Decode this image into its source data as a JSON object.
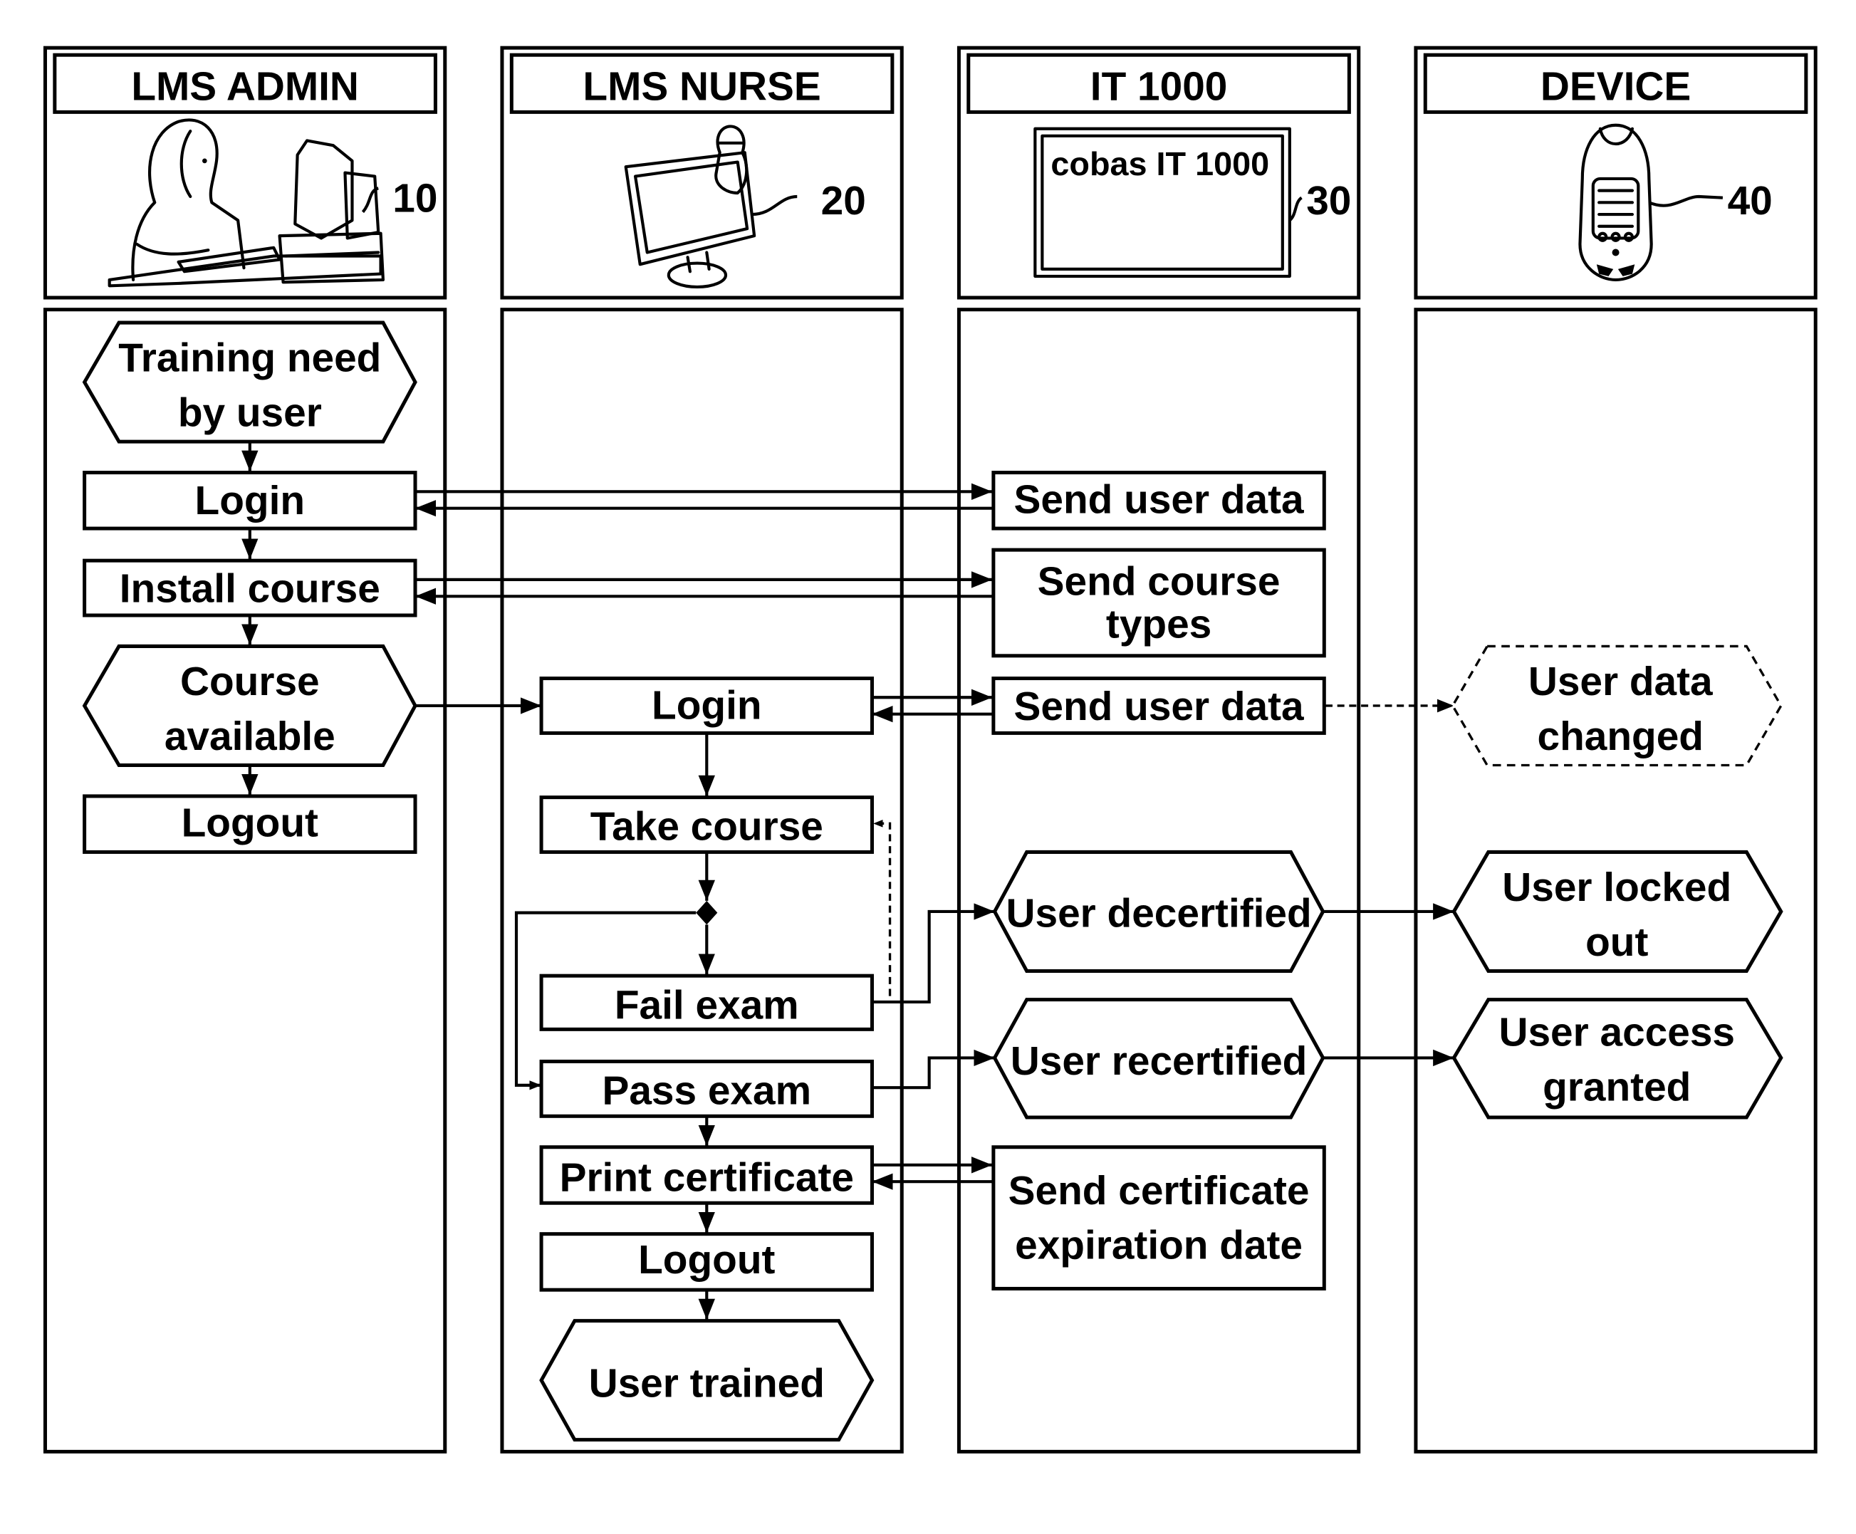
{
  "lanes": [
    {
      "title": "LMS ADMIN",
      "ref": "10",
      "icon": "admin-at-computer-icon"
    },
    {
      "title": "LMS NURSE",
      "ref": "20",
      "icon": "nurse-monitor-icon"
    },
    {
      "title": "IT 1000",
      "ref": "30",
      "icon": "it-screen-icon",
      "screen_label": "cobas IT 1000"
    },
    {
      "title": "DEVICE",
      "ref": "40",
      "icon": "handheld-device-icon"
    }
  ],
  "nodes": {
    "training_need": [
      "Training need",
      "by user"
    ],
    "admin_login": "Login",
    "install_course": "Install course",
    "course_available": [
      "Course",
      "available"
    ],
    "admin_logout": "Logout",
    "nurse_login": "Login",
    "take_course": "Take course",
    "fail_exam": "Fail exam",
    "pass_exam": "Pass exam",
    "print_certificate": "Print certificate",
    "nurse_logout": "Logout",
    "user_trained": "User trained",
    "send_user_data_1": "Send user data",
    "send_course_types": [
      "Send course",
      "types"
    ],
    "send_user_data_2": "Send user data",
    "user_decertified": "User decertified",
    "user_recertified": "User recertified",
    "send_cert_expiration": [
      "Send certificate",
      "expiration date"
    ],
    "user_data_changed": [
      "User data",
      "changed"
    ],
    "user_locked_out": [
      "User locked",
      "out"
    ],
    "user_access_granted": [
      "User access",
      "granted"
    ]
  }
}
